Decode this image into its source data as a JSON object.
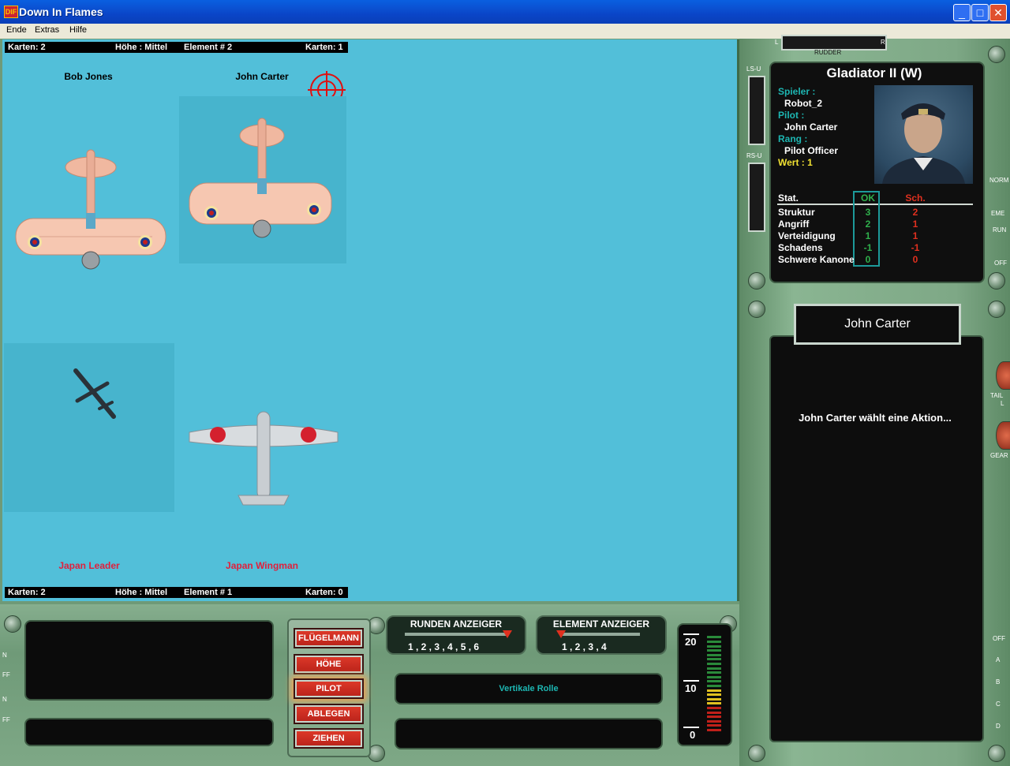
{
  "window": {
    "title": "Down In Flames",
    "icon_text": "DIF",
    "controls": {
      "minimize": "_",
      "maximize": "□",
      "close": "✕"
    }
  },
  "menu": [
    "Ende",
    "Extras",
    "Hilfe"
  ],
  "top_bar": {
    "left_cards": "Karten: 2",
    "altitude": "Höhe : Mittel",
    "element": "Element # 2",
    "right_cards": "Karten: 1"
  },
  "bottom_bar": {
    "left_cards": "Karten: 2",
    "altitude": "Höhe : Mittel",
    "element": "Element # 1",
    "right_cards": "Karten: 0"
  },
  "allied_planes": [
    {
      "name": "Bob Jones"
    },
    {
      "name": "John Carter"
    }
  ],
  "enemy_planes": [
    {
      "name": "Japan Leader"
    },
    {
      "name": "Japan Wingman"
    }
  ],
  "colors": {
    "board": "#52bfd9",
    "enemy_text": "#e0203c",
    "ok_green": "#2fb04c",
    "sch_red": "#e0301f",
    "label_cyan": "#1db6b2",
    "value_yellow": "#f2e233"
  },
  "rudder_label": "RUDDER",
  "rudder_l": "L",
  "rudder_r": "R",
  "side_labels": {
    "lsu": "LS-U",
    "rsu": "RS-U"
  },
  "info": {
    "aircraft": "Gladiator II (W)",
    "player_label": "Spieler :",
    "player": "Robot_2",
    "pilot_label": "Pilot :",
    "pilot": "John Carter",
    "rank_label": "Rang :",
    "rank": "Pilot Officer",
    "value_label": "Wert : 1",
    "stat_header": "Stat.",
    "ok_header": "OK",
    "sch_header": "Sch.",
    "stats": [
      {
        "name": "Struktur",
        "ok": "3",
        "sch": "2"
      },
      {
        "name": "Angriff",
        "ok": "2",
        "sch": "1"
      },
      {
        "name": "Verteidigung",
        "ok": "1",
        "sch": "1"
      },
      {
        "name": "Schadens",
        "ok": "-1",
        "sch": "-1"
      },
      {
        "name": "Schwere Kanone",
        "ok": "0",
        "sch": "0"
      }
    ]
  },
  "selected_pilot": "John Carter",
  "message": "John Carter wählt eine Aktion...",
  "right_edge_labels": [
    "NORM",
    "EME",
    "RUN",
    "OFF",
    "TAIL",
    "L",
    "GEAR",
    "OFF",
    "A",
    "B",
    "C",
    "D"
  ],
  "left_edge_labels": [
    "N",
    "FF",
    "N",
    "FF"
  ],
  "action_buttons": [
    "FLÜGELMANN",
    "HÖHE",
    "PILOT",
    "ABLEGEN",
    "ZIEHEN"
  ],
  "rounds_indicator": {
    "title": "RUNDEN ANZEIGER",
    "numbers": "1 , 2 , 3 , 4 , 5 , 6",
    "value": 6,
    "max": 6
  },
  "element_indicator": {
    "title": "ELEMENT ANZEIGER",
    "numbers": "1  ,  2  ,  3  ,  4",
    "value": 1,
    "max": 4
  },
  "maneuver_text": "Vertikale Rolle",
  "gauge": {
    "labels": [
      "20",
      "10",
      "0"
    ]
  }
}
